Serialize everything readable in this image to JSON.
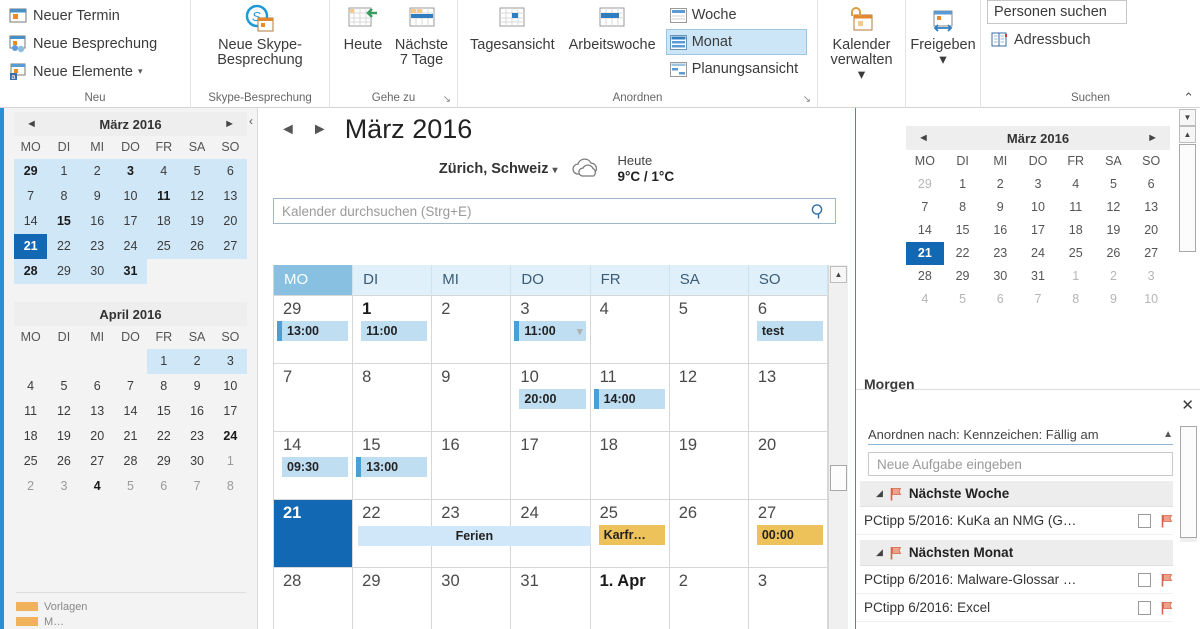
{
  "ribbon": {
    "groups": [
      {
        "name": "Neu",
        "label": "Neu",
        "buttons": [
          {
            "label": "Neuer Termin",
            "icon": "new-appointment-icon"
          },
          {
            "label": "Neue Besprechung",
            "icon": "new-meeting-icon"
          },
          {
            "label": "Neue Elemente",
            "icon": "new-items-icon",
            "caret": "▾"
          }
        ]
      },
      {
        "name": "Skype-Besprechung",
        "label": "Skype-Besprechung",
        "big": [
          {
            "line1": "Neue Skype-",
            "line2": "Besprechung",
            "icon": "skype-meeting-icon"
          }
        ]
      },
      {
        "name": "Gehe zu",
        "label": "Gehe zu",
        "dialog_launcher": "↘",
        "big": [
          {
            "line1": "Heute",
            "line2": "",
            "icon": "today-icon"
          },
          {
            "line1": "Nächste",
            "line2": "7 Tage",
            "icon": "next-7-days-icon"
          }
        ]
      },
      {
        "name": "Anordnen",
        "label": "Anordnen",
        "dialog_launcher": "↘",
        "big": [
          {
            "line1": "Tagesansicht",
            "line2": "",
            "icon": "day-view-icon"
          },
          {
            "line1": "Arbeitswoche",
            "line2": "",
            "icon": "work-week-icon"
          }
        ],
        "views": [
          {
            "label": "Woche",
            "icon": "week-icon",
            "active": false
          },
          {
            "label": "Monat",
            "icon": "month-icon",
            "active": true
          },
          {
            "label": "Planungsansicht",
            "icon": "schedule-view-icon",
            "active": false
          }
        ]
      },
      {
        "name": "Kalender verwalten",
        "label": "",
        "big": [
          {
            "line1": "Kalender",
            "line2": "verwalten ▾",
            "icon": "manage-calendar-icon"
          }
        ]
      },
      {
        "name": "Freigeben",
        "label": "",
        "big": [
          {
            "line1": "Freigeben",
            "line2": "▾",
            "icon": "share-icon"
          }
        ]
      },
      {
        "name": "Suchen",
        "label": "Suchen",
        "fields": [
          {
            "label": "Personen suchen",
            "name": "find-people-field"
          }
        ],
        "buttons": [
          {
            "label": "Adressbuch",
            "icon": "address-book-icon"
          }
        ]
      }
    ],
    "collapse": "⌃"
  },
  "left_pane": {
    "collapse_chevron": "‹",
    "datepickers": [
      {
        "title": "März 2016",
        "prev": "◄",
        "next": "►",
        "dow": [
          "MO",
          "DI",
          "MI",
          "DO",
          "FR",
          "SA",
          "SO"
        ],
        "weeks": [
          [
            {
              "d": "29",
              "bold": true,
              "range": true
            },
            {
              "d": "1",
              "range": true
            },
            {
              "d": "2",
              "range": true
            },
            {
              "d": "3",
              "bold": true,
              "range": true
            },
            {
              "d": "4",
              "range": true
            },
            {
              "d": "5",
              "range": true
            },
            {
              "d": "6",
              "range": true
            }
          ],
          [
            {
              "d": "7",
              "range": true
            },
            {
              "d": "8",
              "range": true
            },
            {
              "d": "9",
              "range": true
            },
            {
              "d": "10",
              "range": true
            },
            {
              "d": "11",
              "bold": true,
              "range": true
            },
            {
              "d": "12",
              "range": true
            },
            {
              "d": "13",
              "range": true
            }
          ],
          [
            {
              "d": "14",
              "range": true
            },
            {
              "d": "15",
              "bold": true,
              "range": true
            },
            {
              "d": "16",
              "range": true
            },
            {
              "d": "17",
              "range": true
            },
            {
              "d": "18",
              "range": true
            },
            {
              "d": "19",
              "range": true
            },
            {
              "d": "20",
              "range": true
            }
          ],
          [
            {
              "d": "21",
              "today": true,
              "range": true
            },
            {
              "d": "22",
              "range": true
            },
            {
              "d": "23",
              "range": true
            },
            {
              "d": "24",
              "range": true
            },
            {
              "d": "25",
              "range": true
            },
            {
              "d": "26",
              "range": true
            },
            {
              "d": "27",
              "range": true
            }
          ],
          [
            {
              "d": "28",
              "bold": true,
              "range": true
            },
            {
              "d": "29",
              "range": true
            },
            {
              "d": "30",
              "range": true
            },
            {
              "d": "31",
              "bold": true,
              "range": true
            },
            {
              "d": ""
            },
            {
              "d": ""
            },
            {
              "d": ""
            }
          ]
        ]
      },
      {
        "title": "April 2016",
        "prev": "",
        "next": "",
        "dow": [
          "MO",
          "DI",
          "MI",
          "DO",
          "FR",
          "SA",
          "SO"
        ],
        "weeks": [
          [
            {
              "d": ""
            },
            {
              "d": ""
            },
            {
              "d": ""
            },
            {
              "d": ""
            },
            {
              "d": "1",
              "range": true
            },
            {
              "d": "2",
              "range": true
            },
            {
              "d": "3",
              "range": true
            }
          ],
          [
            {
              "d": "4"
            },
            {
              "d": "5"
            },
            {
              "d": "6"
            },
            {
              "d": "7"
            },
            {
              "d": "8"
            },
            {
              "d": "9"
            },
            {
              "d": "10"
            }
          ],
          [
            {
              "d": "11"
            },
            {
              "d": "12"
            },
            {
              "d": "13"
            },
            {
              "d": "14"
            },
            {
              "d": "15"
            },
            {
              "d": "16"
            },
            {
              "d": "17"
            }
          ],
          [
            {
              "d": "18"
            },
            {
              "d": "19"
            },
            {
              "d": "20"
            },
            {
              "d": "21"
            },
            {
              "d": "22"
            },
            {
              "d": "23"
            },
            {
              "d": "24",
              "bold": true
            }
          ],
          [
            {
              "d": "25"
            },
            {
              "d": "26"
            },
            {
              "d": "27"
            },
            {
              "d": "28"
            },
            {
              "d": "29"
            },
            {
              "d": "30"
            },
            {
              "d": "1",
              "muted": true
            }
          ],
          [
            {
              "d": "2",
              "muted": true
            },
            {
              "d": "3",
              "muted": true
            },
            {
              "d": "4",
              "bold": true
            },
            {
              "d": "5",
              "muted": true
            },
            {
              "d": "6",
              "muted": true
            },
            {
              "d": "7",
              "muted": true
            },
            {
              "d": "8",
              "muted": true
            }
          ]
        ]
      }
    ],
    "footer": [
      {
        "swatch": "#f0b25b",
        "text": "Vorlagen"
      },
      {
        "swatch": "#f0b25b",
        "text": "M…"
      }
    ]
  },
  "calendar": {
    "prev_arrow": "◄",
    "next_arrow": "►",
    "title": "März 2016",
    "weather": {
      "city": "Zürich, Schweiz",
      "caret": "▾",
      "icon": "cloud-icon",
      "label": "Heute",
      "temps": "9°C / 1°C"
    },
    "search_placeholder": "Kalender durchsuchen (Strg+E)",
    "search_value": "",
    "search_icon": "search-icon",
    "dow": [
      "MO",
      "DI",
      "MI",
      "DO",
      "FR",
      "SA",
      "SO"
    ],
    "selected_dow_index": 0,
    "weeks": [
      {
        "days": [
          {
            "num": "29",
            "appts": [
              {
                "text": "13:00",
                "style": "dark"
              }
            ]
          },
          {
            "num": "1",
            "bold": true,
            "appts": [
              {
                "text": "11:00",
                "style": "light"
              }
            ]
          },
          {
            "num": "2",
            "appts": []
          },
          {
            "num": "3",
            "appts": [
              {
                "text": "11:00",
                "style": "dark",
                "more": "▾"
              }
            ]
          },
          {
            "num": "4",
            "appts": []
          },
          {
            "num": "5",
            "appts": []
          },
          {
            "num": "6",
            "appts": [
              {
                "text": "test",
                "style": "light"
              }
            ]
          }
        ]
      },
      {
        "days": [
          {
            "num": "7",
            "appts": []
          },
          {
            "num": "8",
            "appts": []
          },
          {
            "num": "9",
            "appts": []
          },
          {
            "num": "10",
            "appts": [
              {
                "text": "20:00",
                "style": "light"
              }
            ]
          },
          {
            "num": "11",
            "appts": [
              {
                "text": "14:00",
                "style": "dark"
              }
            ]
          },
          {
            "num": "12",
            "appts": []
          },
          {
            "num": "13",
            "appts": []
          }
        ]
      },
      {
        "days": [
          {
            "num": "14",
            "appts": [
              {
                "text": "09:30",
                "style": "light"
              }
            ]
          },
          {
            "num": "15",
            "appts": [
              {
                "text": "13:00",
                "style": "dark"
              }
            ]
          },
          {
            "num": "16",
            "appts": []
          },
          {
            "num": "17",
            "appts": []
          },
          {
            "num": "18",
            "appts": []
          },
          {
            "num": "19",
            "appts": []
          },
          {
            "num": "20",
            "appts": []
          }
        ]
      },
      {
        "days": [
          {
            "num": "21",
            "today": true,
            "appts": []
          },
          {
            "num": "22",
            "appts": []
          },
          {
            "num": "23",
            "appts": []
          },
          {
            "num": "24",
            "appts": []
          },
          {
            "num": "25",
            "appts": [
              {
                "text": "Karfr…",
                "style": "orange"
              }
            ]
          },
          {
            "num": "26",
            "appts": []
          },
          {
            "num": "27",
            "appts": [
              {
                "text": "00:00",
                "style": "orange"
              }
            ]
          }
        ],
        "span_event": {
          "text": "Ferien",
          "start_col": 1,
          "span_cols": 3
        }
      },
      {
        "days": [
          {
            "num": "28",
            "appts": []
          },
          {
            "num": "29",
            "appts": []
          },
          {
            "num": "30",
            "appts": []
          },
          {
            "num": "31",
            "appts": []
          },
          {
            "num": "1. Apr",
            "bold": true,
            "appts": []
          },
          {
            "num": "2",
            "appts": []
          },
          {
            "num": "3",
            "appts": []
          }
        ]
      }
    ],
    "scroll_up": "▲"
  },
  "right_pane": {
    "close_top": "✕",
    "close_tasks": "✕",
    "datepicker": {
      "title": "März 2016",
      "prev": "◄",
      "next": "►",
      "dow": [
        "MO",
        "DI",
        "MI",
        "DO",
        "FR",
        "SA",
        "SO"
      ],
      "weeks": [
        [
          {
            "d": "29",
            "muted": true
          },
          {
            "d": "1"
          },
          {
            "d": "2"
          },
          {
            "d": "3"
          },
          {
            "d": "4"
          },
          {
            "d": "5"
          },
          {
            "d": "6"
          }
        ],
        [
          {
            "d": "7"
          },
          {
            "d": "8"
          },
          {
            "d": "9"
          },
          {
            "d": "10"
          },
          {
            "d": "11"
          },
          {
            "d": "12"
          },
          {
            "d": "13"
          }
        ],
        [
          {
            "d": "14"
          },
          {
            "d": "15"
          },
          {
            "d": "16"
          },
          {
            "d": "17"
          },
          {
            "d": "18"
          },
          {
            "d": "19"
          },
          {
            "d": "20"
          }
        ],
        [
          {
            "d": "21",
            "today": true
          },
          {
            "d": "22"
          },
          {
            "d": "23"
          },
          {
            "d": "24"
          },
          {
            "d": "25"
          },
          {
            "d": "26"
          },
          {
            "d": "27"
          }
        ],
        [
          {
            "d": "28"
          },
          {
            "d": "29"
          },
          {
            "d": "30"
          },
          {
            "d": "31"
          },
          {
            "d": "1",
            "muted": true
          },
          {
            "d": "2",
            "muted": true
          },
          {
            "d": "3",
            "muted": true
          }
        ],
        [
          {
            "d": "4",
            "muted": true
          },
          {
            "d": "5",
            "muted": true
          },
          {
            "d": "6",
            "muted": true
          },
          {
            "d": "7",
            "muted": true
          },
          {
            "d": "8",
            "muted": true
          },
          {
            "d": "9",
            "muted": true
          },
          {
            "d": "10",
            "muted": true
          }
        ]
      ]
    },
    "morgen_label": "Morgen",
    "tasks": {
      "arrange_by": "Anordnen nach: Kennzeichen: Fällig am",
      "sort_arrow": "▲",
      "new_task_placeholder": "Neue Aufgabe eingeben",
      "new_task_value": "",
      "groups": [
        {
          "triangle": "◢",
          "name": "Nächste Woche",
          "items": [
            {
              "name": "PCtipp 5/2016: KuKa an NMG (G…"
            }
          ]
        },
        {
          "triangle": "◢",
          "name": "Nächsten Monat",
          "items": [
            {
              "name": "PCtipp 6/2016: Malware-Glossar …"
            },
            {
              "name": "PCtipp 6/2016: Excel"
            }
          ]
        }
      ]
    },
    "scroll_up": "▲",
    "scroll_down": "▼"
  },
  "colors": {
    "accent_blue": "#2a8fd4",
    "today_blue": "#1268b3",
    "appt_blue": "#bfdef2",
    "appt_orange": "#eec25b",
    "header_blue": "#dff0fa",
    "header_sel_blue": "#87c0e0"
  }
}
